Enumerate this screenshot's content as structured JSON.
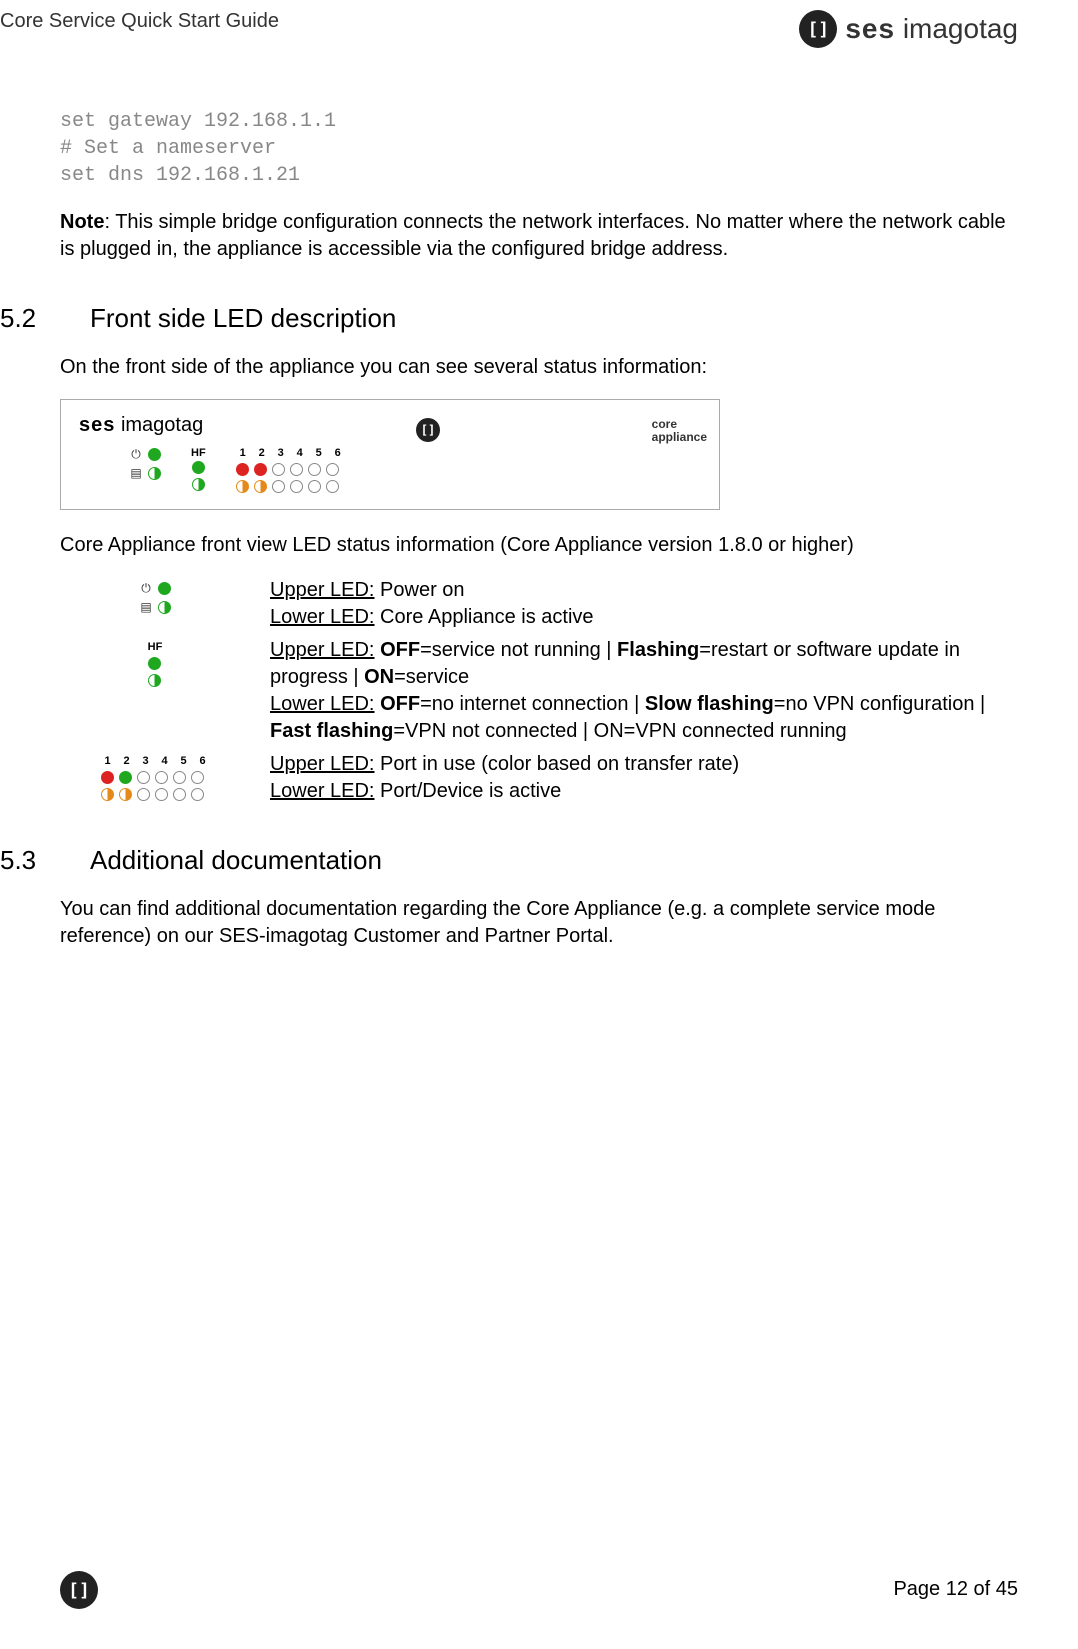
{
  "header": {
    "title": "Core Service Quick Start Guide",
    "brand_ses": "ses",
    "brand_imagotag": "imagotag",
    "brand_glyph": "[]"
  },
  "code": "set gateway 192.168.1.1\n# Set a nameserver\nset dns 192.168.1.21",
  "note_label": "Note",
  "note_text": ": This simple bridge configuration connects the network interfaces. No matter where the network cable is plugged in, the appliance is accessible via the configured bridge address.",
  "sec52": {
    "num": "5.2",
    "title": "Front side LED description"
  },
  "sec52_intro": "On the front side of the appliance you can see several status information:",
  "panel": {
    "brand_ses": "ses",
    "brand_imagotag": "imagotag",
    "center_glyph": "[]",
    "right_l1": "core",
    "right_l2": "appliance",
    "hf_label": "HF",
    "power_sym": "⏻",
    "disk_sym": "▤",
    "nums": [
      "1",
      "2",
      "3",
      "4",
      "5",
      "6"
    ]
  },
  "front_caption": "Core Appliance front view LED status information (Core Appliance version 1.8.0 or higher)",
  "led_rows": {
    "r1": {
      "u1": "Upper LED:",
      "t1": " Power on",
      "u2": "Lower LED:",
      "t2": " Core Appliance is active"
    },
    "r2": {
      "u1": "Upper LED:",
      "off": "OFF",
      "off_t": "=service not running | ",
      "flash": "Flashing",
      "flash_t": "=restart or software update in progress | ",
      "on": "ON",
      "on_t": "=service",
      "u2": "Lower LED:",
      "off2": "OFF",
      "off2_t": "=no internet connection | ",
      "slow": "Slow flashing",
      "slow_t": "=no VPN configuration | ",
      "fast": "Fast flashing",
      "fast_t": "=VPN not connected | ON=VPN connected running"
    },
    "r3": {
      "u1": "Upper LED:",
      "t1": " Port in use (color based on transfer rate)",
      "u2": "Lower LED:",
      "t2": " Port/Device is active"
    }
  },
  "sec53": {
    "num": "5.3",
    "title": "Additional documentation"
  },
  "sec53_body": "You can find additional documentation regarding the Core Appliance (e.g. a complete service mode reference) on our SES-imagotag Customer and Partner Portal.",
  "footer": {
    "glyph": "[]",
    "page": "Page 12 of 45"
  }
}
